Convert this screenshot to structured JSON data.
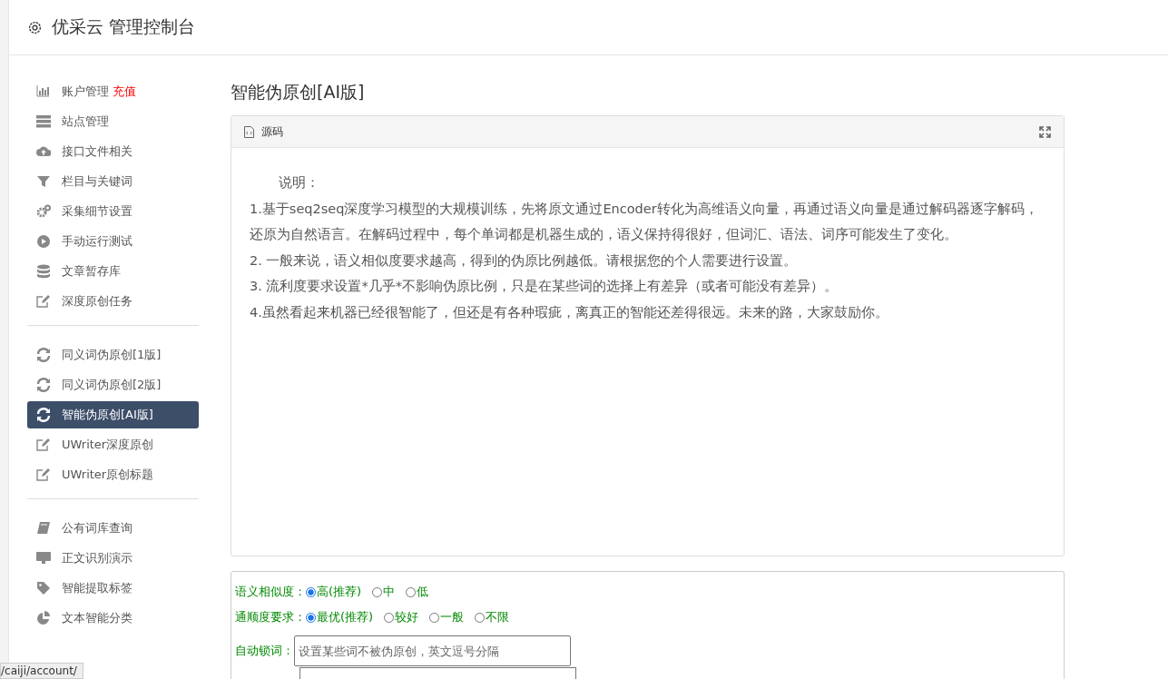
{
  "header": {
    "title": "优采云 管理控制台"
  },
  "sidebar": {
    "groups": [
      {
        "items": [
          {
            "label": "账户管理",
            "badge": "充值",
            "selected": false
          },
          {
            "label": "站点管理",
            "selected": false
          },
          {
            "label": "接口文件相关",
            "selected": false
          },
          {
            "label": "栏目与关键词",
            "selected": false
          },
          {
            "label": "采集细节设置",
            "selected": false
          },
          {
            "label": "手动运行测试",
            "selected": false
          },
          {
            "label": "文章暂存库",
            "selected": false
          },
          {
            "label": "深度原创任务",
            "selected": false
          }
        ]
      },
      {
        "items": [
          {
            "label": "同义词伪原创[1版]",
            "selected": false
          },
          {
            "label": "同义词伪原创[2版]",
            "selected": false
          },
          {
            "label": "智能伪原创[AI版]",
            "selected": true
          },
          {
            "label": "UWriter深度原创",
            "selected": false
          },
          {
            "label": "UWriter原创标题",
            "selected": false
          }
        ]
      },
      {
        "items": [
          {
            "label": "公有词库查询",
            "selected": false
          },
          {
            "label": "正文识别演示",
            "selected": false
          },
          {
            "label": "智能提取标签",
            "selected": false
          },
          {
            "label": "文本智能分类",
            "selected": false
          }
        ]
      }
    ]
  },
  "main": {
    "title": "智能伪原创[AI版]",
    "card": {
      "header": "源码",
      "intro": "说明：",
      "paragraphs": [
        "1.基于seq2seq深度学习模型的大规模训练，先将原文通过Encoder转化为高维语义向量，再通过语义向量是通过解码器逐字解码，还原为自然语言。在解码过程中，每个单词都是机器生成的，语义保持得很好，但词汇、语法、词序可能发生了变化。",
        "2. 一般来说，语义相似度要求越高，得到的伪原比例越低。请根据您的个人需要进行设置。",
        "3. 流利度要求设置*几乎*不影响伪原比例，只是在某些词的选择上有差异（或者可能没有差异）。",
        "4.虽然看起来机器已经很智能了，但还是有各种瑕疵，离真正的智能还差得很远。未来的路，大家鼓励你。"
      ]
    },
    "form": {
      "rows": [
        {
          "kind": "radio",
          "label": "语义相似度：",
          "options": [
            {
              "label": "高(推荐)",
              "selected": true
            },
            {
              "label": "中",
              "selected": false
            },
            {
              "label": "低",
              "selected": false
            }
          ]
        },
        {
          "kind": "radio",
          "label": "通顺度要求：",
          "options": [
            {
              "label": "最优(推荐)",
              "selected": true
            },
            {
              "label": "较好",
              "selected": false
            },
            {
              "label": "一般",
              "selected": false
            },
            {
              "label": "不限",
              "selected": false
            }
          ]
        },
        {
          "kind": "input",
          "label": "自动锁词：",
          "placeholder": "设置某些词不被伪原创，英文逗号分隔"
        }
      ]
    }
  },
  "status_url": "/caiji/account/"
}
